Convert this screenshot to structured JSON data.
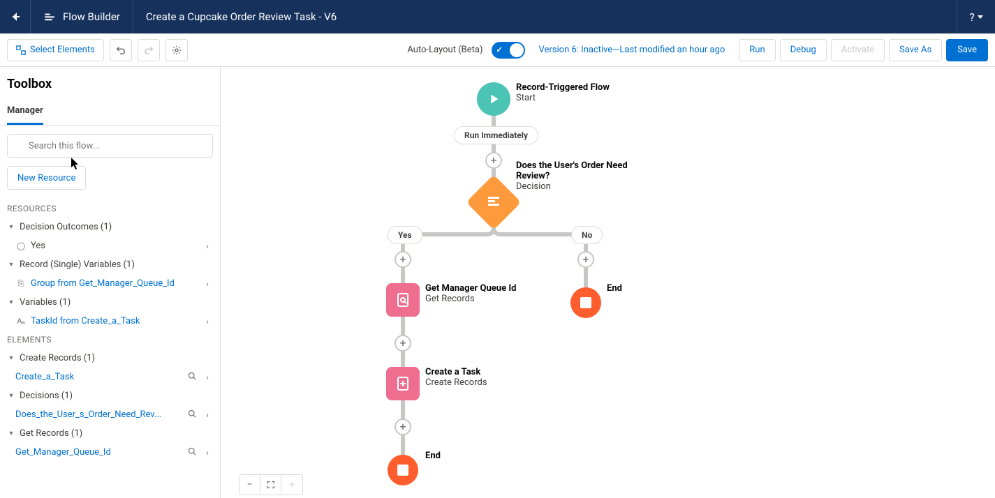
{
  "header": {
    "app_name": "Flow Builder",
    "flow_title": "Create a Cupcake Order Review Task - V6",
    "help_label": "?"
  },
  "toolbar": {
    "select_elements": "Select Elements",
    "auto_layout_label": "Auto-Layout (Beta)",
    "version_status": "Version 6: Inactive—Last modified an hour ago",
    "run": "Run",
    "debug": "Debug",
    "activate": "Activate",
    "save_as": "Save As",
    "save": "Save"
  },
  "sidebar": {
    "toolbox_title": "Toolbox",
    "tab_manager": "Manager",
    "search_placeholder": "Search this flow...",
    "new_resource": "New Resource",
    "resources_label": "RESOURCES",
    "elements_label": "ELEMENTS",
    "groups": {
      "decision_outcomes": "Decision Outcomes (1)",
      "yes_item": "Yes",
      "record_single_vars": "Record (Single) Variables (1)",
      "group_from_get_manager": "Group from Get_Manager_Queue_Id",
      "variables": "Variables (1)",
      "taskid_from_create": "TaskId from Create_a_Task",
      "create_records": "Create Records (1)",
      "create_a_task": "Create_a_Task",
      "decisions": "Decisions (1)",
      "does_user_order": "Does_the_User_s_Order_Need_Rev...",
      "get_records": "Get Records (1)",
      "get_manager_queue": "Get_Manager_Queue_Id"
    }
  },
  "canvas": {
    "start_title": "Record-Triggered Flow",
    "start_sub": "Start",
    "run_immediately": "Run Immediately",
    "decision_title": "Does the User's Order Need Review?",
    "decision_sub": "Decision",
    "yes": "Yes",
    "no": "No",
    "get_manager_title": "Get Manager Queue Id",
    "get_manager_sub": "Get Records",
    "create_task_title": "Create a Task",
    "create_task_sub": "Create Records",
    "end": "End"
  }
}
